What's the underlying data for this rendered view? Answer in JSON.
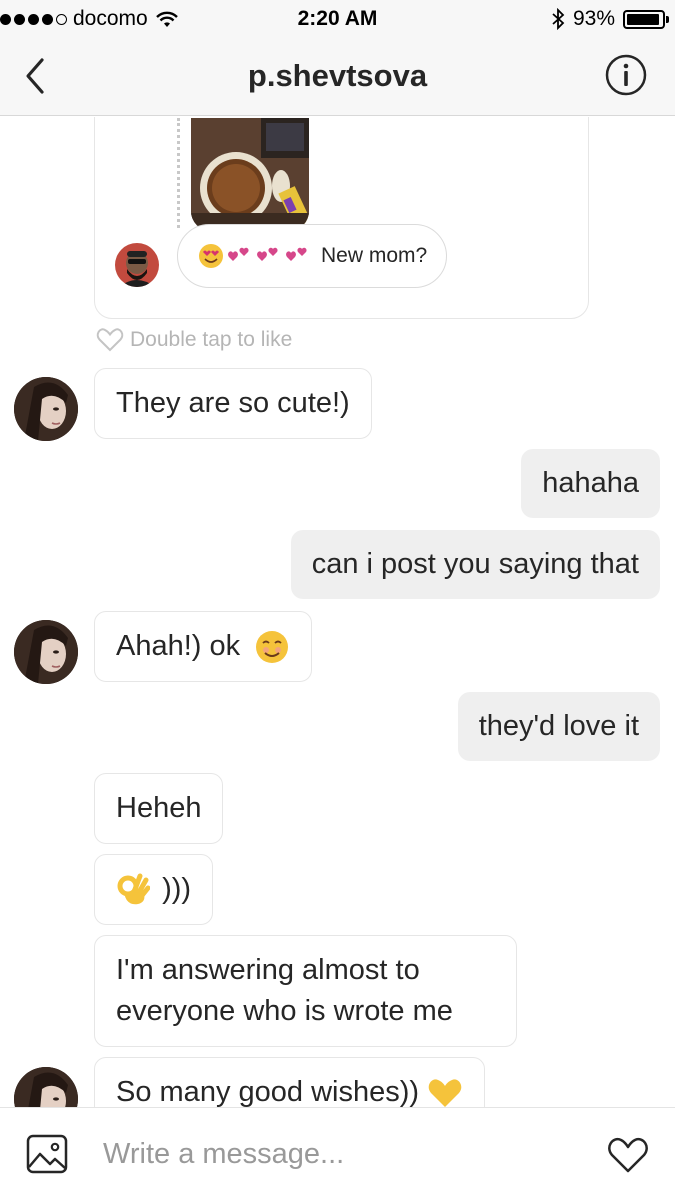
{
  "status_bar": {
    "carrier": "docomo",
    "time": "2:20 AM",
    "battery_percent": "93%",
    "battery_level": 0.93,
    "signal_bars": 4
  },
  "header": {
    "title": "p.shevtsova"
  },
  "shared_story": {
    "reply_text": "New mom?",
    "like_label": "Double tap to like"
  },
  "messages": [
    {
      "direction": "in",
      "text": "They are so cute!)"
    },
    {
      "direction": "out",
      "text": "hahaha"
    },
    {
      "direction": "out",
      "text": "can i post you saying that"
    },
    {
      "direction": "in",
      "text": "Ahah!) ok",
      "emoji": "smiling-face-emoji"
    },
    {
      "direction": "out",
      "text": "they'd love it"
    },
    {
      "direction": "in",
      "text": "Heheh"
    },
    {
      "direction": "in",
      "text": ")))",
      "emoji": "ok-hand-emoji"
    },
    {
      "direction": "in",
      "text": "I'm answering almost to everyone who is wrote me"
    },
    {
      "direction": "in",
      "text": "So many good wishes))",
      "emoji": "yellow-heart-emoji"
    }
  ],
  "composer": {
    "placeholder": "Write a message..."
  },
  "colors": {
    "outgoing_bubble": "#efefef",
    "incoming_border": "#e6e6e6",
    "header_bg": "#f7f7f7",
    "emoji_heart": "#d6478a",
    "emoji_yellow": "#f5c33b"
  }
}
